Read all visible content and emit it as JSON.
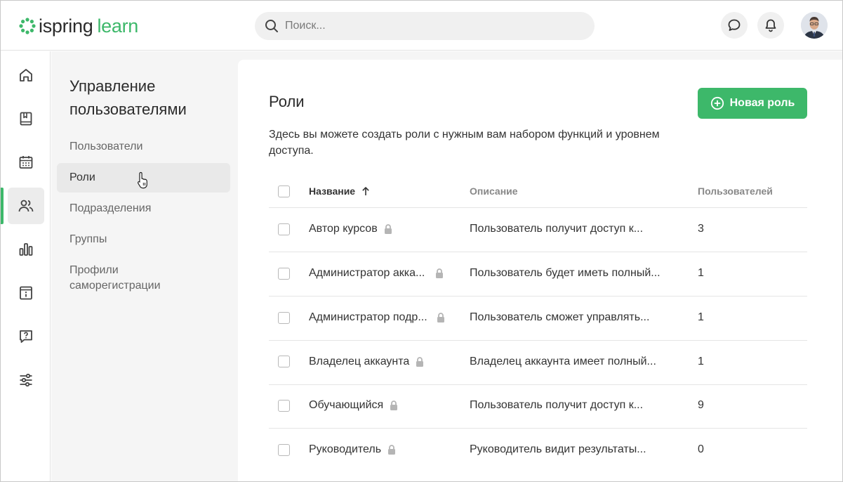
{
  "app": {
    "logo_word1": "ispring",
    "logo_word2": "learn",
    "brand_color": "#3db86a"
  },
  "search": {
    "placeholder": "Поиск..."
  },
  "header_icons": [
    "chat-icon",
    "bell-icon",
    "avatar"
  ],
  "rail": {
    "items": [
      "home-icon",
      "book-icon",
      "calendar-icon",
      "users-icon",
      "reports-icon",
      "info-icon",
      "question-icon",
      "settings-icon"
    ],
    "active": "users-icon"
  },
  "subnav": {
    "title": "Управление пользователями",
    "items": [
      {
        "label": "Пользователи",
        "active": false
      },
      {
        "label": "Роли",
        "active": true
      },
      {
        "label": "Подразделения",
        "active": false
      },
      {
        "label": "Группы",
        "active": false
      },
      {
        "label": "Профили саморегистрации",
        "active": false
      }
    ]
  },
  "main": {
    "title": "Роли",
    "description": "Здесь вы можете создать роли с нужным вам набором функций и уровнем доступа.",
    "new_button_label": "Новая роль"
  },
  "table": {
    "columns": {
      "name": "Название",
      "description": "Описание",
      "users": "Пользователей"
    },
    "sort": {
      "column": "name",
      "direction": "asc"
    },
    "rows": [
      {
        "name": "Автор курсов",
        "description": "Пользователь получит доступ к...",
        "users": "3",
        "locked": true
      },
      {
        "name": "Администратор акка...",
        "description": "Пользователь будет иметь полный...",
        "users": "1",
        "locked": true
      },
      {
        "name": "Администратор подр...",
        "description": "Пользователь сможет управлять...",
        "users": "1",
        "locked": true
      },
      {
        "name": "Владелец аккаунта",
        "description": "Владелец аккаунта имеет полный...",
        "users": "1",
        "locked": true
      },
      {
        "name": "Обучающийся",
        "description": "Пользователь получит доступ к...",
        "users": "9",
        "locked": true
      },
      {
        "name": "Руководитель",
        "description": "Руководитель видит результаты...",
        "users": "0",
        "locked": true
      }
    ]
  }
}
